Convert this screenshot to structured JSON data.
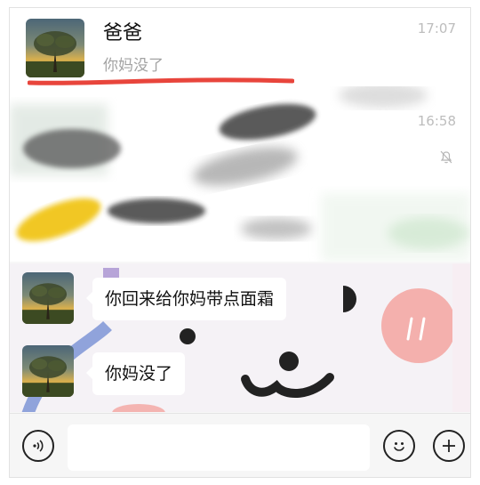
{
  "chat_list": {
    "top_item": {
      "name": "爸爸",
      "preview": "你妈没了",
      "time": "17:07",
      "avatar_icon": "tree-sunset-avatar"
    },
    "second_item": {
      "time": "16:58",
      "mute_icon": "bell-muted-icon"
    },
    "highlight_color": "#e8453c"
  },
  "conversation": {
    "messages": [
      {
        "text": "你回来给你妈带点面霜",
        "sender_avatar": "tree-sunset-avatar"
      },
      {
        "text": "你妈没了",
        "sender_avatar": "tree-sunset-avatar"
      }
    ]
  },
  "input_bar": {
    "voice_icon": "voice-icon",
    "input_value": "",
    "emoji_icon": "emoji-icon",
    "add_icon": "plus-icon"
  }
}
